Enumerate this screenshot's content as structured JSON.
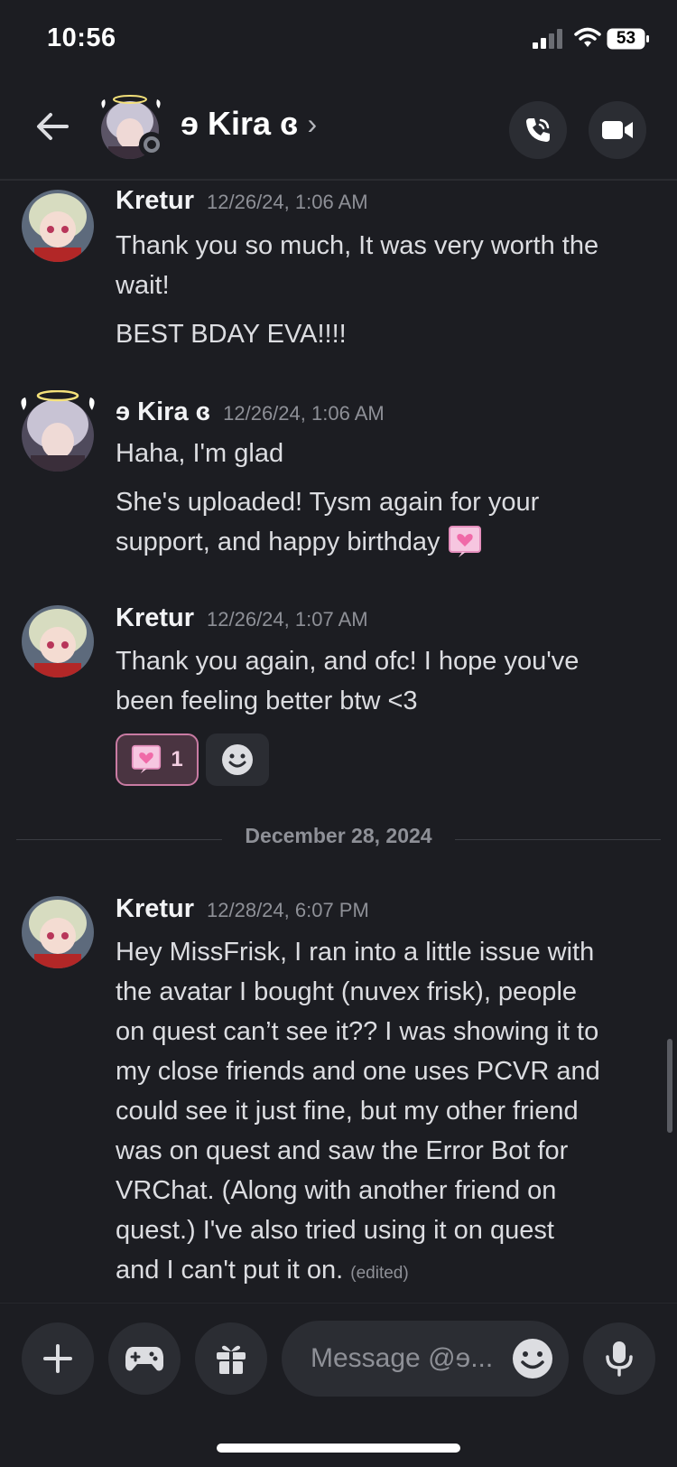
{
  "status_bar": {
    "time": "10:56",
    "battery": "53"
  },
  "header": {
    "title": "ɘ Kira ɞ",
    "chevron": "›"
  },
  "messages": [
    {
      "author": "Kretur",
      "timestamp": "12/26/24, 1:06 AM",
      "lines": [
        "Thank you so much, It was very worth the",
        "wait!",
        "BEST BDAY EVA!!!!"
      ]
    },
    {
      "author": "ɘ Kira ɞ",
      "timestamp": "12/26/24, 1:06 AM",
      "lines": [
        "Haha, I'm glad",
        "She's uploaded! Tysm again for your",
        "support, and happy birthday"
      ]
    },
    {
      "author": "Kretur",
      "timestamp": "12/26/24, 1:07 AM",
      "lines": [
        "Thank you again, and ofc! I hope you've",
        "been feeling better btw <3"
      ],
      "reaction_count": "1"
    },
    {
      "author": "Kretur",
      "timestamp": "12/28/24, 6:07 PM",
      "lines": [
        "Hey MissFrisk, I ran into a little issue with",
        "the avatar I bought (nuvex frisk), people",
        "on quest can’t see it?? I was showing it to",
        "my close friends and one uses PCVR and",
        "could see it just fine, but my other friend",
        "was on quest and saw the Error Bot for",
        "VRChat. (Along with another friend on",
        "quest.) I've also tried using it on quest",
        "and I can't put it on."
      ],
      "edited": "(edited)"
    }
  ],
  "date_divider": "December 28, 2024",
  "composer": {
    "placeholder": "Message @ɘ..."
  },
  "icons": {
    "back": "back-arrow-icon",
    "call": "phone-call-icon",
    "video": "video-camera-icon",
    "add": "plus-icon",
    "games": "gamepad-icon",
    "gift": "gift-icon",
    "emoji": "smiley-icon",
    "mic": "microphone-icon",
    "heart_reaction": "pink-heart-icon"
  },
  "colors": {
    "background": "#1c1d22",
    "surface": "#2b2d33",
    "reaction_border": "#c97ba3",
    "reaction_bg": "#4a3441"
  }
}
